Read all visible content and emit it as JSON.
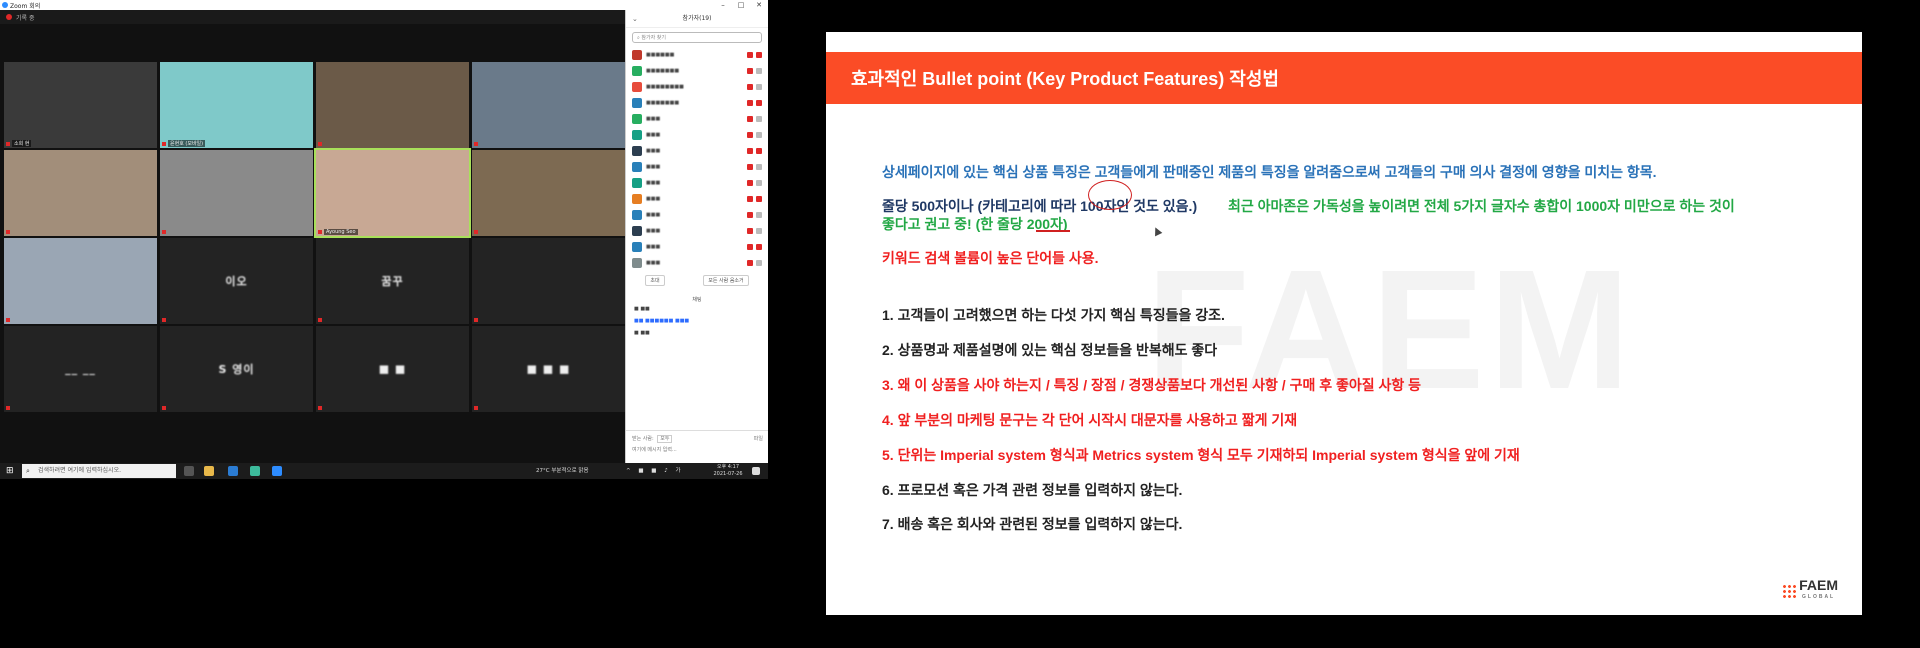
{
  "zoom": {
    "window_title": "Zoom 회의",
    "recording_label": "기록 중",
    "tiles": [
      {
        "name": "소희 현",
        "bg": "#3a3a3a"
      },
      {
        "name": "윤현호 (모바일)",
        "bg": "#7fc9c9"
      },
      {
        "name": "",
        "bg": "#6b5a48"
      },
      {
        "name": "",
        "bg": "#6a7a8a"
      },
      {
        "name": "",
        "bg": "#a28e7a"
      },
      {
        "name": "",
        "bg": "#8a8a8a"
      },
      {
        "name": "Ayoung Seo",
        "bg": "#c8a894"
      },
      {
        "name": "",
        "bg": "#7d6a52"
      },
      {
        "name": "",
        "bg": "#9aa6b4"
      },
      {
        "name": "",
        "bg": "#232323",
        "blurname": "이오"
      },
      {
        "name": "",
        "bg": "#232323",
        "blurname": "꿈꾸"
      },
      {
        "name": "",
        "bg": "#232323"
      },
      {
        "name": "",
        "bg": "#232323",
        "blurname": "__ __"
      },
      {
        "name": "",
        "bg": "#232323",
        "blurname": "S 영이"
      },
      {
        "name": "",
        "bg": "#232323",
        "blurname": "■ ■"
      },
      {
        "name": "",
        "bg": "#232323",
        "blurname": "■ ■ ■"
      }
    ],
    "participants_panel": {
      "title": "참가자(19)",
      "search_placeholder": "참가자 찾기",
      "participants": [
        {
          "name": "■■■■■■",
          "color": "#c0392b"
        },
        {
          "name": "■■■■■■■",
          "color": "#27ae60"
        },
        {
          "name": "■■■■■■■■",
          "color": "#e74c3c"
        },
        {
          "name": "■■■■■■■",
          "color": "#2980b9"
        },
        {
          "name": "■■■",
          "color": "#27ae60"
        },
        {
          "name": "■■■",
          "color": "#16a085"
        },
        {
          "name": "■■■",
          "color": "#2c3e50"
        },
        {
          "name": "■■■",
          "color": "#2980b9"
        },
        {
          "name": "■■■",
          "color": "#16a085"
        },
        {
          "name": "■■■",
          "color": "#e67e22"
        },
        {
          "name": "■■■",
          "color": "#2980b9"
        },
        {
          "name": "■■■",
          "color": "#2c3e50"
        },
        {
          "name": "■■■",
          "color": "#2980b9"
        },
        {
          "name": "■■■",
          "color": "#7f8c8d"
        }
      ],
      "invite_label": "초대",
      "mute_all_label": "모든 사람 음소거",
      "chat_title": "채팅",
      "chat_lines": [
        "■ ■■",
        "■■ ■■■■■■ ■■■",
        "■ ■■"
      ],
      "chat_to_label": "받는 사람:",
      "chat_to_value": "모두",
      "chat_file_label": "파일",
      "chat_placeholder": "여기에 메시지 입력..."
    },
    "taskbar": {
      "search_placeholder": "검색하려면 여기에 입력하십시오.",
      "weather": "27°C 부분적으로 맑음",
      "time": "오후 4:17",
      "date": "2021-07-26"
    }
  },
  "slide": {
    "title": "효과적인 Bullet point (Key Product Features) 작성법",
    "watermark": "FAEM",
    "intro": "상세페이지에 있는 핵심 상품 특징은 고객들에게 판매중인 제품의 특징을 알려줌으로써 고객들의 구매 의사 결정에 영향을 미치는 항목.",
    "line2_part1": "줄당 500자이나 (카테고리에 따라 100자인 것도 있음.)",
    "line2_part2": "최근 아마존은 가독성을 높이려면 전체 5가지 글자수 총합이 1000자 미만으로 하는 것이",
    "line2_part3": "좋다고 권고 중! (한 줄당 200자)",
    "keyword_line": "키워드 검색 볼륨이 높은 단어들 사용.",
    "points": [
      {
        "text": "1. 고객들이 고려했으면 하는 다섯 가지 핵심 특징들을 강조.",
        "color": "black"
      },
      {
        "text": "2. 상품명과 제품설명에 있는 핵심 정보들을 반복해도 좋다",
        "color": "black"
      },
      {
        "text": "3. 왜 이 상품을 사야 하는지 / 특징 / 장점 / 경쟁상품보다 개선된 사항 / 구매 후 좋아질 사항 등",
        "color": "red"
      },
      {
        "text": "4. 앞 부분의 마케팅 문구는 각 단어 시작시 대문자를 사용하고 짧게 기재",
        "color": "red"
      },
      {
        "text": "5. 단위는 Imperial system 형식과 Metrics system 형식 모두 기재하되 Imperial system 형식을 앞에 기재",
        "color": "red"
      },
      {
        "text": "6. 프로모션 혹은 가격 관련 정보를 입력하지 않는다.",
        "color": "black"
      },
      {
        "text": "7. 배송 혹은 회사와 관련된 정보를 입력하지 않는다.",
        "color": "black"
      }
    ],
    "logo_text": "FAEM",
    "logo_sub": "GLOBAL"
  }
}
